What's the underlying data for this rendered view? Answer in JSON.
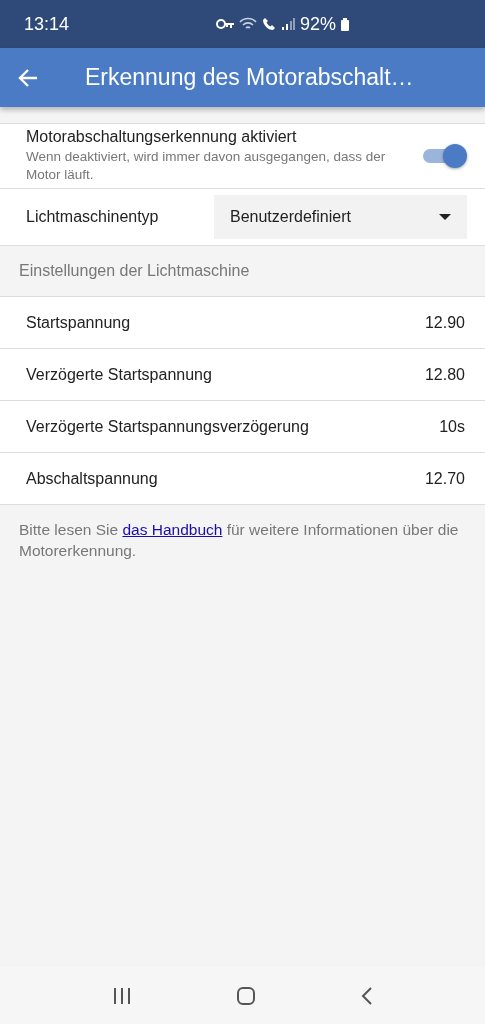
{
  "status_bar": {
    "time": "13:14",
    "battery": "92%"
  },
  "app_bar": {
    "title": "Erkennung des Motorabschalt…"
  },
  "toggle": {
    "label": "Motorabschaltungserkennung aktiviert",
    "description": "Wenn deaktiviert, wird immer davon ausgegangen, dass der Motor läuft.",
    "on": true
  },
  "dropdown": {
    "label": "Lichtmaschinentyp",
    "value": "Benutzerdefiniert"
  },
  "section": {
    "title": "Einstellungen der Lichtmaschine"
  },
  "settings": [
    {
      "label": "Startspannung",
      "value": "12.90"
    },
    {
      "label": "Verzögerte Startspannung",
      "value": "12.80"
    },
    {
      "label": "Verzögerte Startspannungsverzögerung",
      "value": "10s"
    },
    {
      "label": "Abschaltspannung",
      "value": "12.70"
    }
  ],
  "footer": {
    "before": "Bitte lesen Sie",
    "link": "das Handbuch",
    "after": "für weitere Informationen über die Motorerkennung."
  }
}
